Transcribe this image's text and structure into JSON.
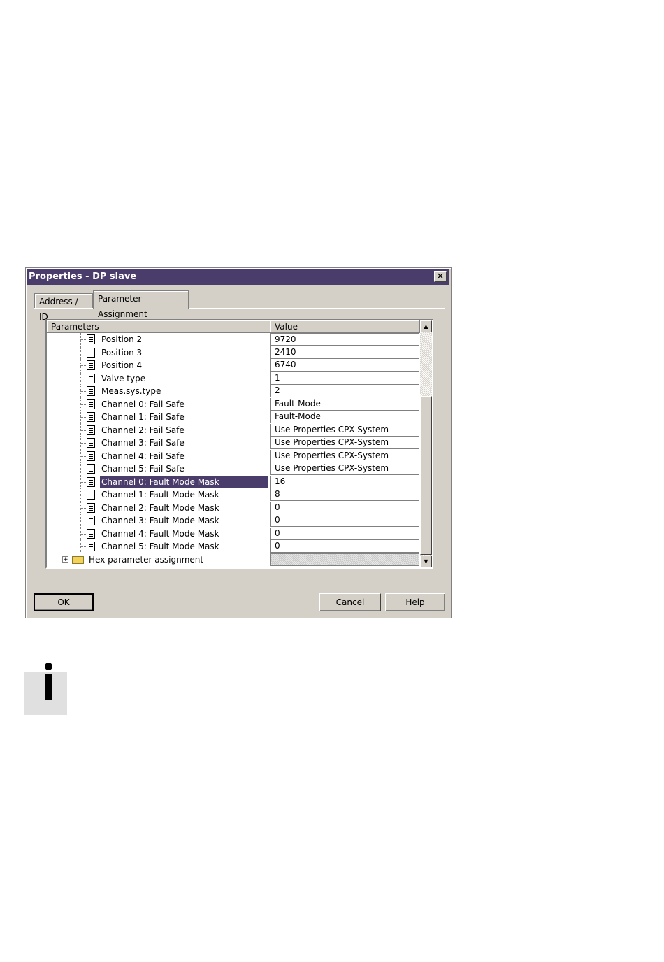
{
  "dialog": {
    "title": "Properties - DP slave",
    "close_label": "✕",
    "tabs": [
      {
        "label": "Address / ID"
      },
      {
        "label": "Parameter Assignment"
      }
    ]
  },
  "grid": {
    "columns": {
      "parameters": "Parameters",
      "value": "Value"
    },
    "rows": [
      {
        "name": "Position 2",
        "value": "9720"
      },
      {
        "name": "Position 3",
        "value": "2410"
      },
      {
        "name": "Position 4",
        "value": "6740"
      },
      {
        "name": "Valve type",
        "value": "1"
      },
      {
        "name": "Meas.sys.type",
        "value": "2"
      },
      {
        "name": "Channel 0: Fail Safe",
        "value": "Fault-Mode"
      },
      {
        "name": "Channel 1: Fail Safe",
        "value": "Fault-Mode"
      },
      {
        "name": "Channel 2: Fail Safe",
        "value": "Use Properties CPX-System"
      },
      {
        "name": "Channel 3: Fail Safe",
        "value": "Use Properties CPX-System"
      },
      {
        "name": "Channel 4: Fail Safe",
        "value": "Use Properties CPX-System"
      },
      {
        "name": "Channel 5: Fail Safe",
        "value": "Use Properties CPX-System"
      },
      {
        "name": "Channel 0: Fault Mode Mask",
        "value": "16"
      },
      {
        "name": "Channel 1: Fault Mode Mask",
        "value": "8"
      },
      {
        "name": "Channel 2: Fault Mode Mask",
        "value": "0"
      },
      {
        "name": "Channel 3: Fault Mode Mask",
        "value": "0"
      },
      {
        "name": "Channel 4: Fault Mode Mask",
        "value": "0"
      },
      {
        "name": "Channel 5: Fault Mode Mask",
        "value": "0"
      }
    ],
    "selected_row": "Channel 0: Fault Mode Mask",
    "hex_folder": {
      "label": "Hex parameter assignment",
      "expand_symbol": "+"
    },
    "scroll_up": "▲",
    "scroll_down": "▼"
  },
  "buttons": {
    "ok": "OK",
    "cancel": "Cancel",
    "help": "Help"
  },
  "icons": {
    "tree_item": "parameter-doc-icon",
    "folder": "folder-icon",
    "info": "info-icon"
  },
  "colors": {
    "titlebar": "#4b3d6b",
    "selection": "#4b3d6b",
    "dialog_bg": "#d4d0c8"
  }
}
